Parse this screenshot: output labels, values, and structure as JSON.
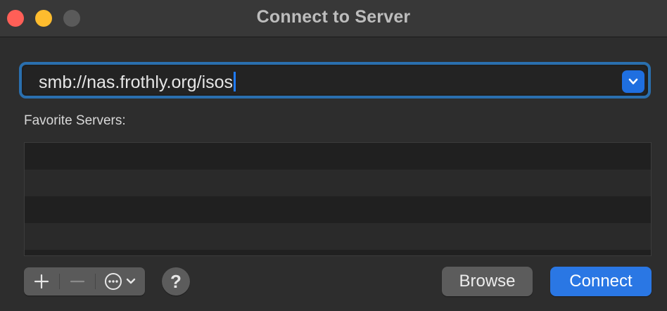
{
  "window": {
    "title": "Connect to Server"
  },
  "address": {
    "value": "smb://nas.frothly.org/isos",
    "history_icon": "chevron-down-icon"
  },
  "favorites": {
    "label": "Favorite Servers:",
    "items": []
  },
  "toolbar": {
    "add_icon": "plus-icon",
    "remove_icon": "minus-icon",
    "more_icon": "ellipsis-circle-icon",
    "more_menu_icon": "chevron-down-icon",
    "help_label": "?"
  },
  "buttons": {
    "browse_label": "Browse",
    "connect_label": "Connect"
  },
  "colors": {
    "accent": "#2a77e4",
    "focus_ring": "#2a6fae",
    "close": "#ff5f57",
    "minimize": "#febc2e"
  }
}
